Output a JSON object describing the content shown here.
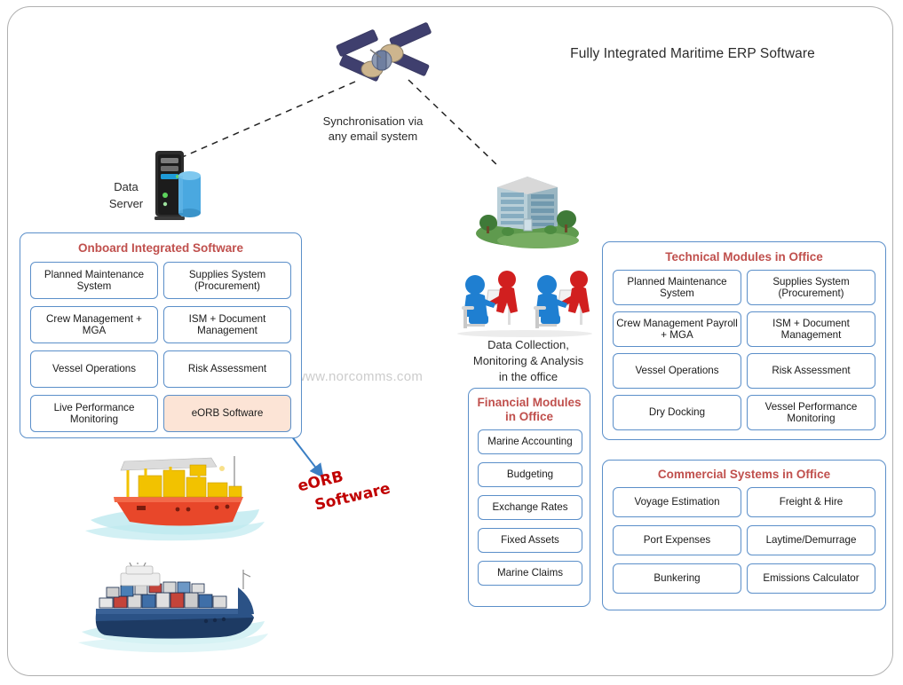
{
  "title": "Fully Integrated Maritime ERP Software",
  "watermark": "www.norcomms.com",
  "captions": {
    "sync_line1": "Synchronisation via",
    "sync_line2": "any email system",
    "server_line1": "Data",
    "server_line2": "Server",
    "data_collection_line1": "Data Collection,",
    "data_collection_line2": "Monitoring & Analysis",
    "data_collection_line3": "in the office",
    "eorb_line1": "eORB",
    "eorb_line2": "Software"
  },
  "colors": {
    "panel_title": "#C0504D",
    "panel_border": "#5B8FC9",
    "highlight_fill": "#FCE4D6",
    "callout_red": "#C00000",
    "arrow_blue": "#3B7FC4",
    "frame_gray": "#B0B0B0"
  },
  "panels": {
    "onboard": {
      "title": "Onboard Integrated Software",
      "modules": [
        {
          "label": "Planned Maintenance System",
          "highlight": false
        },
        {
          "label": "Supplies System (Procurement)",
          "highlight": false
        },
        {
          "label": "Crew Management + MGA",
          "highlight": false
        },
        {
          "label": "ISM + Document Management",
          "highlight": false
        },
        {
          "label": "Vessel Operations",
          "highlight": false
        },
        {
          "label": "Risk Assessment",
          "highlight": false
        },
        {
          "label": "Live Performance Monitoring",
          "highlight": false
        },
        {
          "label": "eORB Software",
          "highlight": true
        }
      ]
    },
    "technical": {
      "title": "Technical Modules in Office",
      "modules": [
        {
          "label": "Planned Maintenance System",
          "highlight": false
        },
        {
          "label": "Supplies System (Procurement)",
          "highlight": false
        },
        {
          "label": "Crew Management Payroll + MGA",
          "highlight": false
        },
        {
          "label": "ISM + Document Management",
          "highlight": false
        },
        {
          "label": "Vessel Operations",
          "highlight": false
        },
        {
          "label": "Risk Assessment",
          "highlight": false
        },
        {
          "label": "Dry Docking",
          "highlight": false
        },
        {
          "label": "Vessel Performance Monitoring",
          "highlight": false
        }
      ]
    },
    "commercial": {
      "title": "Commercial Systems in Office",
      "modules": [
        {
          "label": "Voyage Estimation",
          "highlight": false
        },
        {
          "label": "Freight & Hire",
          "highlight": false
        },
        {
          "label": "Port Expenses",
          "highlight": false
        },
        {
          "label": "Laytime/Demurrage",
          "highlight": false
        },
        {
          "label": "Bunkering",
          "highlight": false
        },
        {
          "label": "Emissions Calculator",
          "highlight": false
        }
      ]
    },
    "financial": {
      "title_line1": "Financial Modules",
      "title_line2": "in Office",
      "modules": [
        {
          "label": "Marine Accounting",
          "highlight": false
        },
        {
          "label": "Budgeting",
          "highlight": false
        },
        {
          "label": "Exchange Rates",
          "highlight": false
        },
        {
          "label": "Fixed Assets",
          "highlight": false
        },
        {
          "label": "Marine Claims",
          "highlight": false
        }
      ]
    }
  },
  "artwork": [
    {
      "name": "satellite-image",
      "label": "satellite"
    },
    {
      "name": "data-server-image",
      "label": "data server tower with database cylinder"
    },
    {
      "name": "office-building-image",
      "label": "office building with trees"
    },
    {
      "name": "office-workers-image",
      "label": "two pairs of people at laptops"
    },
    {
      "name": "offshore-supply-vessel-image",
      "label": "red and yellow offshore supply vessel"
    },
    {
      "name": "container-ship-image",
      "label": "blue container ship"
    }
  ]
}
